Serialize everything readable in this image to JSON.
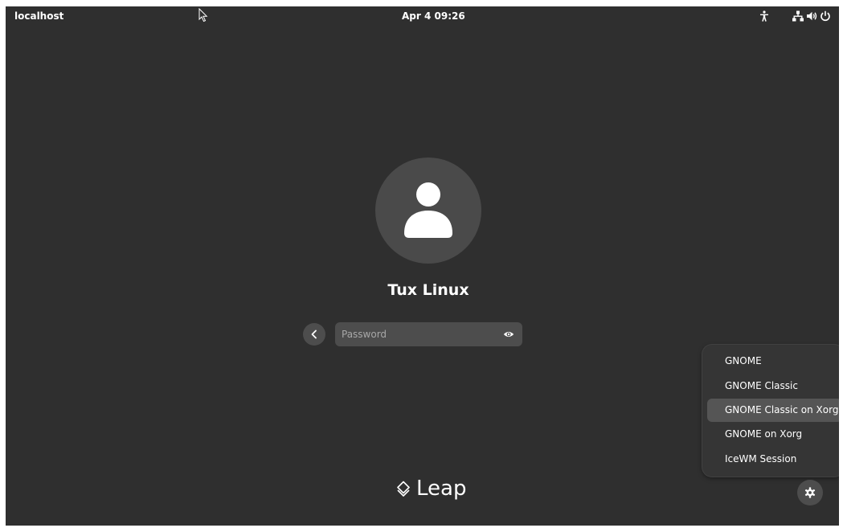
{
  "topbar": {
    "hostname": "localhost",
    "datetime": "Apr 4  09:26",
    "tray_icons": [
      "accessibility-icon",
      "network-wired-icon",
      "volume-icon",
      "power-icon"
    ]
  },
  "login": {
    "username": "Tux Linux",
    "password_placeholder": "Password"
  },
  "session_menu": {
    "items": [
      {
        "label": "GNOME",
        "selected": false
      },
      {
        "label": "GNOME Classic",
        "selected": false
      },
      {
        "label": "GNOME Classic on Xorg",
        "selected": true
      },
      {
        "label": "GNOME on Xorg",
        "selected": false
      },
      {
        "label": "IceWM Session",
        "selected": false
      }
    ]
  },
  "branding": {
    "logo_text": "Leap"
  },
  "colors": {
    "background": "#2f2f2f",
    "widget": "#4d4d4d",
    "avatar_bg": "#4a4a4a",
    "menu_bg": "#353535",
    "menu_selected": "#555555",
    "text": "#ffffff"
  }
}
